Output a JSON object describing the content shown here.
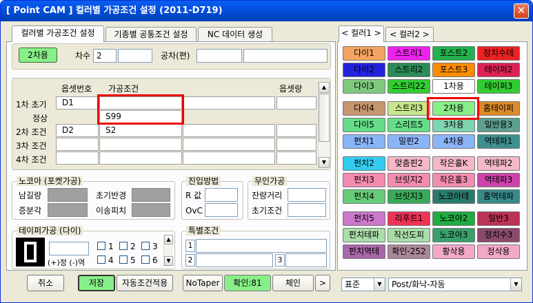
{
  "window": {
    "title": "[ Point CAM ]  컬러별 가공조건 설정  (2011-D719)",
    "close_label": "✕"
  },
  "left_tabs": [
    {
      "label": "컬러별 가공조건 설정"
    },
    {
      "label": "기종별 공통조건 설정"
    },
    {
      "label": "NC 데이터 생성"
    }
  ],
  "top_row": {
    "color_button": "2차용",
    "order_label": "차수",
    "order_value": "2",
    "order_extra": "",
    "tol_label": "공차(편)",
    "tol_value1": "",
    "tol_value2": ""
  },
  "grid": {
    "headers": {
      "offset": "옵셋번호",
      "condition": "가공조건",
      "amount": "옵셋량"
    },
    "rows": [
      {
        "label": "1차 초기",
        "offset": "D1",
        "condition": "",
        "extra": "",
        "amount": ""
      },
      {
        "label": "정상",
        "offset": "",
        "condition": "S99",
        "extra": "",
        "amount": ""
      },
      {
        "label": "2차 조건",
        "offset": "D2",
        "condition": "S2",
        "extra": "",
        "amount": ""
      },
      {
        "label": "3차 조건",
        "offset": "",
        "condition": "",
        "extra": "",
        "amount": ""
      },
      {
        "label": "4차 조건",
        "offset": "",
        "condition": "",
        "extra": "",
        "amount": ""
      }
    ]
  },
  "nokoa": {
    "title": "노코아 (포켓가공)",
    "remain": "남길량",
    "init_radius": "초기반경",
    "increment": "증분각",
    "move_pitch": "이송피치"
  },
  "entry": {
    "title": "진입방법",
    "r_label": "R 값",
    "r_value": "",
    "ovc_label": "OvC",
    "ovc_value": ""
  },
  "nonentry": {
    "title": "무인가공",
    "remain_dist": "잔량거리",
    "remain_value": "",
    "init_cond": "초기조건",
    "init_value": ""
  },
  "taper": {
    "title": "테이퍼가공 (다이)",
    "sign_label": "(+)정 (-)역",
    "value": "",
    "checks": [
      "1",
      "2",
      "3",
      "4",
      "5",
      "6"
    ]
  },
  "special": {
    "title": "특별조건",
    "labels": [
      "1",
      "2",
      "3"
    ],
    "values": [
      "",
      "",
      ""
    ]
  },
  "bottom_buttons": {
    "cancel": "취소",
    "save": "저장",
    "auto": "자동조건적용",
    "notaper": "NoTaper",
    "confirm": "확인:81",
    "chain": "체인",
    "next": ">"
  },
  "right_tabs": [
    {
      "label": "< 컬러1 >"
    },
    {
      "label": "< 컬러2 >"
    }
  ],
  "palette": [
    [
      {
        "label": "다이1",
        "bg": "#f4a460",
        "fg": "#000000"
      },
      {
        "label": "스트리1",
        "bg": "#ee22ee",
        "fg": "#000000"
      },
      {
        "label": "포스트2",
        "bg": "#22b14c",
        "fg": "#000000"
      },
      {
        "label": "장치수테",
        "bg": "#ee2222",
        "fg": "#000000"
      }
    ],
    [
      {
        "label": "다이2",
        "bg": "#2222dd",
        "fg": "#000000"
      },
      {
        "label": "스트리2",
        "bg": "#2e8b57",
        "fg": "#000000"
      },
      {
        "label": "포스트3",
        "bg": "#ff8c00",
        "fg": "#000000"
      },
      {
        "label": "테이퍼2",
        "bg": "#dd2255",
        "fg": "#000000"
      }
    ],
    [
      {
        "label": "다이3",
        "bg": "#7fc97f",
        "fg": "#000000"
      },
      {
        "label": "스트리22",
        "bg": "#33cc33",
        "fg": "#000000"
      },
      {
        "label": "1차용",
        "bg": "#ffffff",
        "fg": "#000000"
      },
      {
        "label": "테이퍼3",
        "bg": "#33cc33",
        "fg": "#000000"
      }
    ],
    [
      {
        "label": "다이4",
        "bg": "#c8966e",
        "fg": "#000000"
      },
      {
        "label": "스트리3",
        "bg": "#c8e68c",
        "fg": "#000000"
      },
      {
        "label": "2차용",
        "bg": "#88ee88",
        "fg": "#000000"
      },
      {
        "label": "홈테이퍼",
        "bg": "#dd8a2a",
        "fg": "#000000"
      }
    ],
    [
      {
        "label": "다이5",
        "bg": "#66dd88",
        "fg": "#000000"
      },
      {
        "label": "스리트5",
        "bg": "#66dd88",
        "fg": "#000000"
      },
      {
        "label": "3차용",
        "bg": "#7fd4b0",
        "fg": "#000000"
      },
      {
        "label": "일반용3",
        "bg": "#5f9f8f",
        "fg": "#000000"
      }
    ],
    [
      {
        "label": "펀치1",
        "bg": "#8ab4f8",
        "fg": "#000000"
      },
      {
        "label": "밀핀2",
        "bg": "#8ab4f8",
        "fg": "#000000"
      },
      {
        "label": "4차용",
        "bg": "#8ab4f8",
        "fg": "#000000"
      },
      {
        "label": "역테파1",
        "bg": "#3f8f8f",
        "fg": "#000000"
      }
    ],
    [
      {
        "label": "펀치2",
        "bg": "#33ccee",
        "fg": "#000000"
      },
      {
        "label": "맞춤핀2",
        "bg": "#f4b8c8",
        "fg": "#000000"
      },
      {
        "label": "작은홀K",
        "bg": "#f4b8c8",
        "fg": "#000000"
      },
      {
        "label": "역테파2",
        "bg": "#f4b8c8",
        "fg": "#000000"
      }
    ],
    [
      {
        "label": "펀치3",
        "bg": "#f48cb0",
        "fg": "#000000"
      },
      {
        "label": "브릿지2",
        "bg": "#f48cb0",
        "fg": "#000000"
      },
      {
        "label": "작은홀3",
        "bg": "#f48cb0",
        "fg": "#000000"
      },
      {
        "label": "역테파3",
        "bg": "#cc44aa",
        "fg": "#000000"
      }
    ],
    [
      {
        "label": "펀치4",
        "bg": "#66cc77",
        "fg": "#000000"
      },
      {
        "label": "브릿지3",
        "bg": "#3aaa5a",
        "fg": "#000000"
      },
      {
        "label": "노코아테",
        "bg": "#2a7a6a",
        "fg": "#000000"
      },
      {
        "label": "홈역테파",
        "bg": "#3a8a8a",
        "fg": "#000000"
      }
    ],
    [
      {
        "label": "펀치5",
        "bg": "#cc77cc",
        "fg": "#000000"
      },
      {
        "label": "리푸트1",
        "bg": "#ee3355",
        "fg": "#000000"
      },
      {
        "label": "노코아2",
        "bg": "#22aa44",
        "fg": "#000000"
      },
      {
        "label": "일반3",
        "bg": "#bb3355",
        "fg": "#000000"
      }
    ],
    [
      {
        "label": "펀치테파",
        "bg": "#aaddaa",
        "fg": "#000000"
      },
      {
        "label": "직선도피",
        "bg": "#aaddaa",
        "fg": "#000000"
      },
      {
        "label": "노코아3",
        "bg": "#3aa06a",
        "fg": "#000000"
      },
      {
        "label": "정치수3",
        "bg": "#8a4a6a",
        "fg": "#000000"
      }
    ],
    [
      {
        "label": "펀치역테",
        "bg": "#aa66aa",
        "fg": "#000000"
      },
      {
        "label": "확인-252",
        "bg": "#aa8899",
        "fg": "#000000"
      },
      {
        "label": "황삭용",
        "bg": "#f4a8c8",
        "fg": "#000000"
      },
      {
        "label": "정삭용",
        "bg": "#f4a8c8",
        "fg": "#000000"
      }
    ]
  ],
  "footer": {
    "standard": "표준",
    "post": "Post/화낙-자동"
  }
}
